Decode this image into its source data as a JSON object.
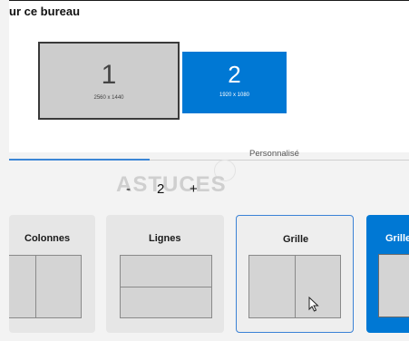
{
  "header": {
    "title": "ur ce bureau"
  },
  "monitors": [
    {
      "number": "1",
      "resolution": "2560 x 1440",
      "selected": false
    },
    {
      "number": "2",
      "resolution": "1920 x 1080",
      "selected": true
    }
  ],
  "tabs": {
    "custom_label": "Personnalisé"
  },
  "stepper": {
    "minus": "-",
    "value": "2",
    "plus": "+"
  },
  "watermark": {
    "text": "ASTUCES"
  },
  "layouts": [
    {
      "label": "Colonnes",
      "selected": false
    },
    {
      "label": "Lignes",
      "selected": false
    },
    {
      "label": "Grille",
      "selected": true
    },
    {
      "label": "Grille",
      "selected": false
    }
  ],
  "colors": {
    "accent": "#0078d4",
    "selection_border": "#3b82d6",
    "background": "#f3f3f3"
  }
}
